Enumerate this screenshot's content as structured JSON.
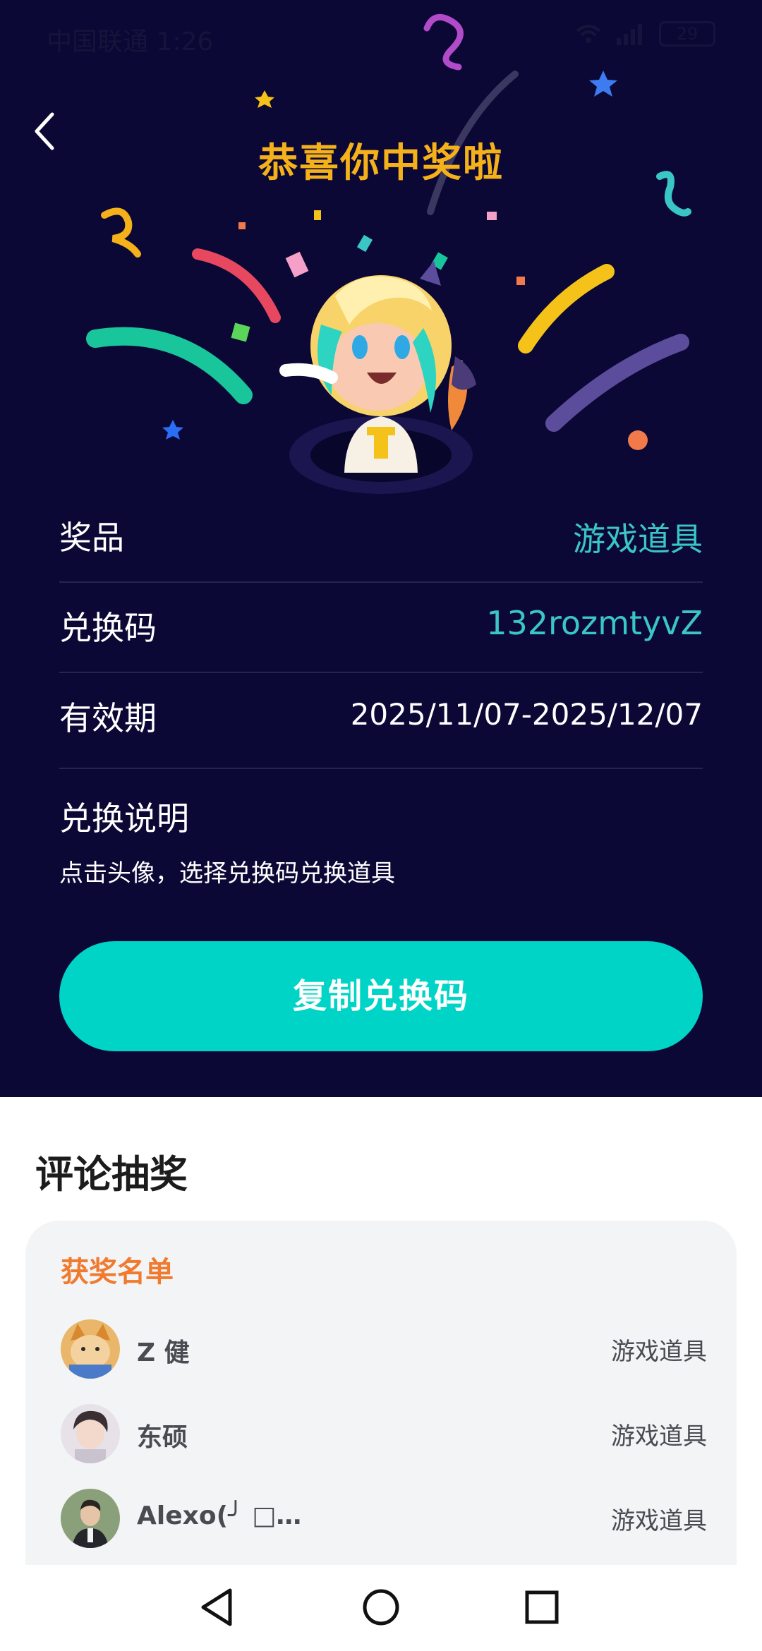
{
  "status_bar": {
    "carrier_time": "中国联通 1:26",
    "battery": "29"
  },
  "header": {
    "title": "恭喜你中奖啦"
  },
  "prize_info": {
    "prize_label": "奖品",
    "prize_value": "游戏道具",
    "code_label": "兑换码",
    "code_value": "132rozmtyvZ",
    "validity_label": "有效期",
    "validity_value": "2025/11/07-2025/12/07",
    "desc_title": "兑换说明",
    "desc_text": "点击头像，选择兑换码兑换道具"
  },
  "copy_button": {
    "label": "复制兑换码"
  },
  "comment_lottery": {
    "title": "评论抽奖",
    "winners_heading": "获奖名单",
    "winners": [
      {
        "name": "Z 健",
        "prize": "游戏道具"
      },
      {
        "name": "东硕",
        "prize": "游戏道具"
      },
      {
        "name": "Alexo(╯ □…",
        "prize": "游戏道具"
      }
    ]
  },
  "colors": {
    "background": "#0b0836",
    "accent": "#00d4c6",
    "title": "#f5b11a",
    "winners_heading": "#f07a2e"
  }
}
